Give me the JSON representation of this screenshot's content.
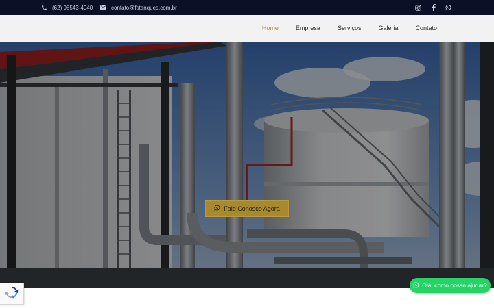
{
  "topbar": {
    "phone": "(62) 98543-4040",
    "email": "contato@fstanques.com.br",
    "icons": {
      "phone": "phone-icon",
      "email": "envelope-icon"
    },
    "socials": [
      "instagram-icon",
      "facebook-icon",
      "whatsapp-icon"
    ]
  },
  "nav": {
    "items": [
      {
        "label": "Home",
        "active": true
      },
      {
        "label": "Empresa",
        "active": false
      },
      {
        "label": "Serviços",
        "active": false
      },
      {
        "label": "Galeria",
        "active": false
      },
      {
        "label": "Contato",
        "active": false
      }
    ]
  },
  "hero": {
    "cta_label": "Fale Conosco Agora",
    "cta_icon": "whatsapp-icon"
  },
  "recaptcha": {
    "icon": "recaptcha-icon"
  },
  "whatsapp_chat": {
    "label": "Olá, como posso ajudar?",
    "icon": "whatsapp-icon"
  },
  "colors": {
    "topbar_bg": "#0c1027",
    "nav_bg": "#f2f2f2",
    "accent_gold": "#b3922e",
    "cta_bg": "#a88a2e",
    "whatsapp_green": "#25d366"
  }
}
